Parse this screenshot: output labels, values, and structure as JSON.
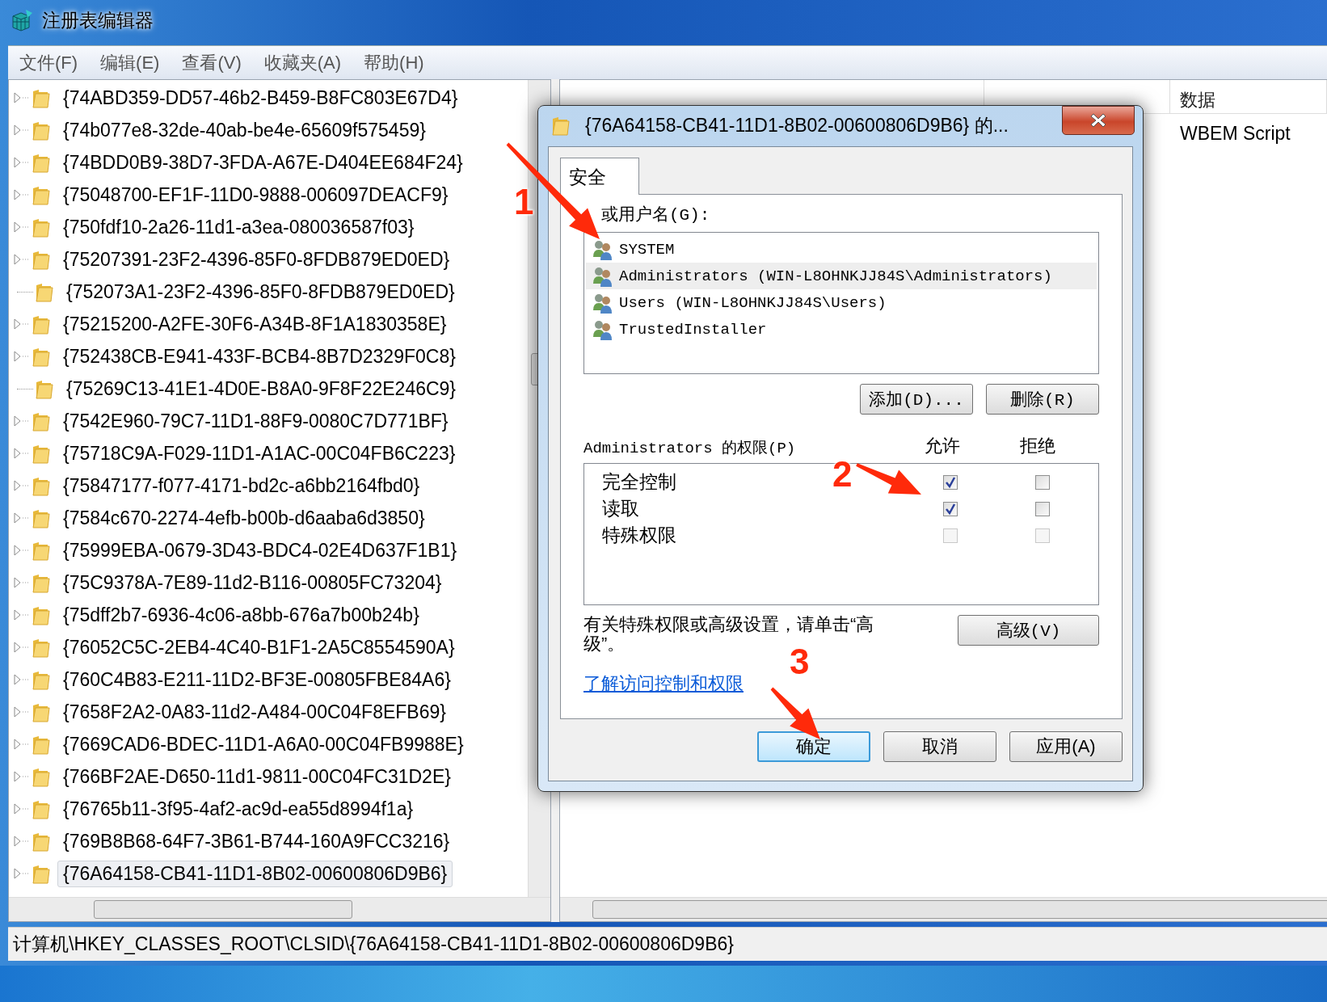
{
  "window": {
    "title": "注册表编辑器"
  },
  "menu": [
    "文件(F)",
    "编辑(E)",
    "查看(V)",
    "收藏夹(A)",
    "帮助(H)"
  ],
  "tree": {
    "items": [
      {
        "label": "{74ABD359-DD57-46b2-B459-B8FC803E67D4}",
        "expandable": true,
        "selected": false
      },
      {
        "label": "{74b077e8-32de-40ab-be4e-65609f575459}",
        "expandable": true,
        "selected": false
      },
      {
        "label": "{74BDD0B9-38D7-3FDA-A67E-D404EE684F24}",
        "expandable": true,
        "selected": false
      },
      {
        "label": "{75048700-EF1F-11D0-9888-006097DEACF9}",
        "expandable": true,
        "selected": false
      },
      {
        "label": "{750fdf10-2a26-11d1-a3ea-080036587f03}",
        "expandable": true,
        "selected": false
      },
      {
        "label": "{75207391-23F2-4396-85F0-8FDB879ED0ED}",
        "expandable": true,
        "selected": false
      },
      {
        "label": "{752073A1-23F2-4396-85F0-8FDB879ED0ED}",
        "expandable": false,
        "selected": false
      },
      {
        "label": "{75215200-A2FE-30F6-A34B-8F1A1830358E}",
        "expandable": true,
        "selected": false
      },
      {
        "label": "{752438CB-E941-433F-BCB4-8B7D2329F0C8}",
        "expandable": true,
        "selected": false
      },
      {
        "label": "{75269C13-41E1-4D0E-B8A0-9F8F22E246C9}",
        "expandable": false,
        "selected": false
      },
      {
        "label": "{7542E960-79C7-11D1-88F9-0080C7D771BF}",
        "expandable": true,
        "selected": false
      },
      {
        "label": "{75718C9A-F029-11D1-A1AC-00C04FB6C223}",
        "expandable": true,
        "selected": false
      },
      {
        "label": "{75847177-f077-4171-bd2c-a6bb2164fbd0}",
        "expandable": true,
        "selected": false
      },
      {
        "label": "{7584c670-2274-4efb-b00b-d6aaba6d3850}",
        "expandable": true,
        "selected": false
      },
      {
        "label": "{75999EBA-0679-3D43-BDC4-02E4D637F1B1}",
        "expandable": true,
        "selected": false
      },
      {
        "label": "{75C9378A-7E89-11d2-B116-00805FC73204}",
        "expandable": true,
        "selected": false
      },
      {
        "label": "{75dff2b7-6936-4c06-a8bb-676a7b00b24b}",
        "expandable": true,
        "selected": false
      },
      {
        "label": "{76052C5C-2EB4-4C40-B1F1-2A5C8554590A}",
        "expandable": true,
        "selected": false
      },
      {
        "label": "{760C4B83-E211-11D2-BF3E-00805FBE84A6}",
        "expandable": true,
        "selected": false
      },
      {
        "label": "{7658F2A2-0A83-11d2-A484-00C04F8EFB69}",
        "expandable": true,
        "selected": false
      },
      {
        "label": "{7669CAD6-BDEC-11D1-A6A0-00C04FB9988E}",
        "expandable": true,
        "selected": false
      },
      {
        "label": "{766BF2AE-D650-11d1-9811-00C04FC31D2E}",
        "expandable": true,
        "selected": false
      },
      {
        "label": "{76765b11-3f95-4af2-ac9d-ea55d8994f1a}",
        "expandable": true,
        "selected": false
      },
      {
        "label": "{769B8B68-64F7-3B61-B744-160A9FCC3216}",
        "expandable": true,
        "selected": false
      },
      {
        "label": "{76A64158-CB41-11D1-8B02-00600806D9B6}",
        "expandable": true,
        "selected": true
      }
    ]
  },
  "values": {
    "columns": [
      "数据"
    ],
    "rows": [
      {
        "data": "WBEM Script"
      }
    ]
  },
  "status_bar": "计算机\\HKEY_CLASSES_ROOT\\CLSID\\{76A64158-CB41-11D1-8B02-00600806D9B6}",
  "dialog": {
    "title": "{76A64158-CB41-11D1-8B02-00600806D9B6} 的...",
    "tabs": [
      {
        "label": "安全",
        "selected": true
      }
    ],
    "users_label": "或用户名(G):",
    "users": [
      {
        "name": "SYSTEM",
        "selected": false
      },
      {
        "name": "Administrators (WIN-L8OHNKJJ84S\\Administrators)",
        "selected": true
      },
      {
        "name": "Users (WIN-L8OHNKJJ84S\\Users)",
        "selected": false
      },
      {
        "name": "TrustedInstaller",
        "selected": false
      }
    ],
    "user_buttons": [
      "添加(D)...",
      "删除(R)"
    ],
    "permissions_label": "Administrators 的权限(P)",
    "allow_header": "允许",
    "deny_header": "拒绝",
    "permissions": [
      {
        "name": "完全控制",
        "allow": true,
        "deny": false,
        "disabled": false
      },
      {
        "name": "读取",
        "allow": true,
        "deny": false,
        "disabled": false
      },
      {
        "name": "特殊权限",
        "allow": false,
        "deny": false,
        "disabled": true
      }
    ],
    "note": "有关特殊权限或高级设置，请单击“高级”。",
    "advanced_button": "高级(V)",
    "link": "了解访问控制和权限",
    "buttons": [
      {
        "label": "确定",
        "default": true
      },
      {
        "label": "取消",
        "default": false
      },
      {
        "label": "应用(A)",
        "default": false
      }
    ]
  },
  "annotations": [
    {
      "label": "1"
    },
    {
      "label": "2"
    },
    {
      "label": "3"
    }
  ]
}
